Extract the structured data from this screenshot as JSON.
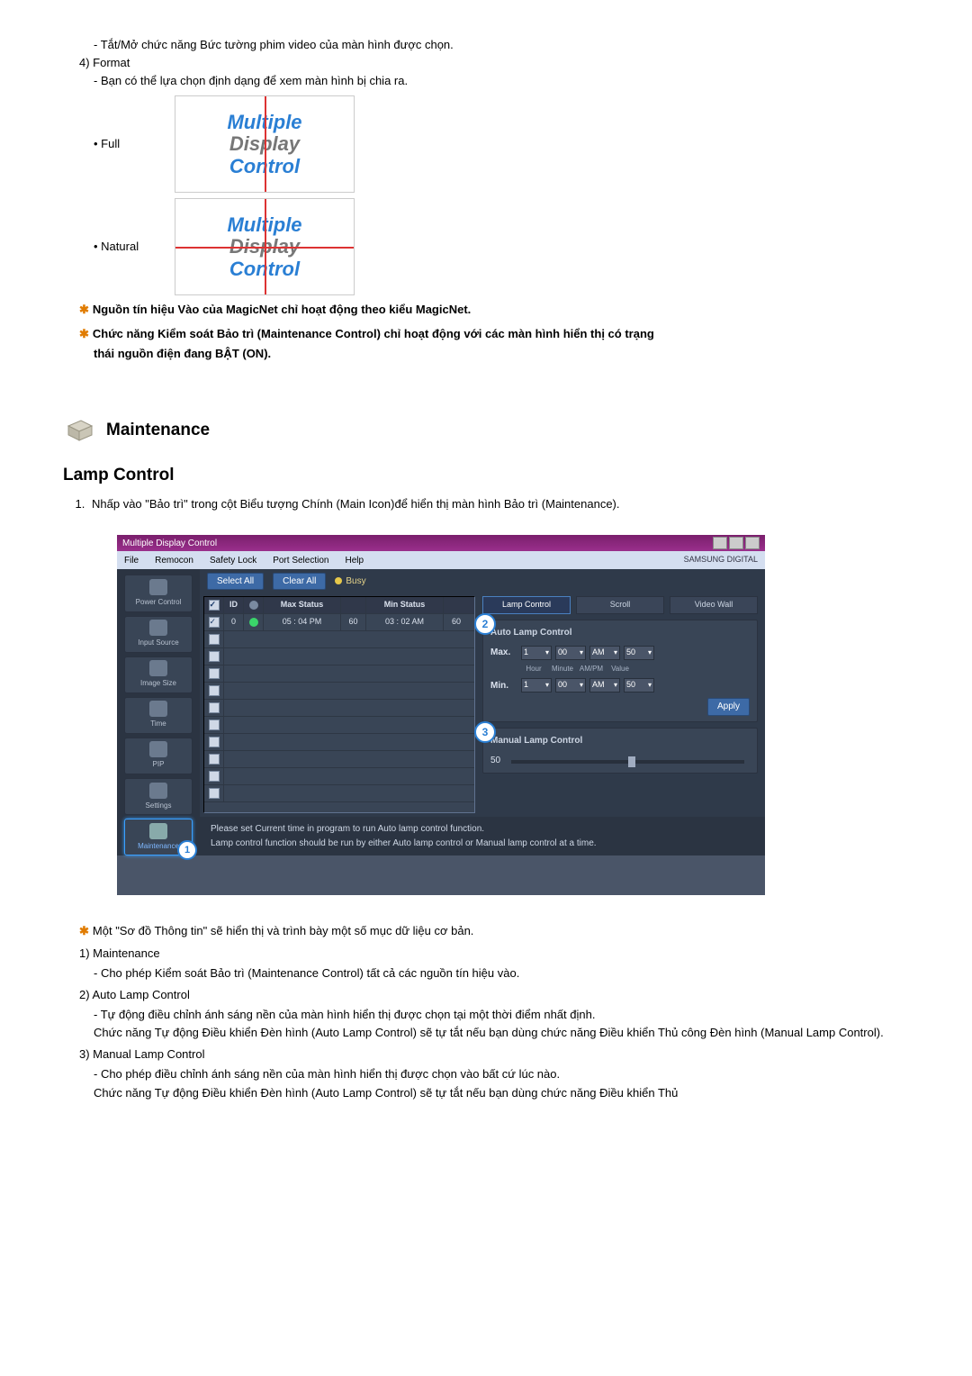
{
  "top": {
    "dash1": "- Tắt/Mở chức năng Bức tường phim video của màn hình được chọn.",
    "item4": "4)  Format",
    "dash4": "- Bạn có thể lựa chọn định dạng để xem màn hình bị chia ra.",
    "opt_full": "Full",
    "opt_natural": "Natural",
    "thumb_line1": "Multiple",
    "thumb_line2": "Display",
    "thumb_line3": "Control",
    "star1": "Nguồn tín hiệu Vào của MagicNet chỉ hoạt động theo kiểu MagicNet.",
    "star2a": "Chức năng Kiểm soát Bảo trì (Maintenance Control) chỉ hoạt động với các màn hình hiển thị có trạng",
    "star2b": "thái nguồn điện đang BẬT (ON)."
  },
  "maintenance": {
    "heading": "Maintenance",
    "subhead": "Lamp Control",
    "step1": "Nhấp vào \"Bảo trì\" trong cột Biểu tượng Chính (Main Icon)để hiển thị màn hình Bảo trì (Maintenance)."
  },
  "screenshot": {
    "title": "Multiple Display Control",
    "menu": {
      "file": "File",
      "remocon": "Remocon",
      "safety": "Safety Lock",
      "port": "Port Selection",
      "help": "Help",
      "brand": "SAMSUNG DIGITAL"
    },
    "btn_select_all": "Select All",
    "btn_clear_all": "Clear All",
    "busy": "Busy",
    "sidebar": [
      {
        "label": "Power Control"
      },
      {
        "label": "Input Source"
      },
      {
        "label": "Image Size"
      },
      {
        "label": "Time"
      },
      {
        "label": "PIP"
      },
      {
        "label": "Settings"
      },
      {
        "label": "Maintenance"
      }
    ],
    "badge_maintenance": "1",
    "grid": {
      "hdr_chk": "✓",
      "hdr_id": "ID",
      "hdr_st": "",
      "hdr_max": "Max Status",
      "hdr_maxv": "",
      "hdr_min": "Min Status",
      "hdr_minv": "",
      "row": {
        "id": "0",
        "max": "05 : 04 PM",
        "maxv": "60",
        "min": "03 : 02 AM",
        "minv": "60"
      }
    },
    "tabs": {
      "lamp": "Lamp Control",
      "scroll": "Scroll",
      "video": "Video Wall"
    },
    "auto": {
      "badge": "2",
      "title": "Auto Lamp Control",
      "max": "Max.",
      "min": "Min.",
      "h1": "1",
      "m1": "00",
      "ap1": "AM",
      "v1": "50",
      "h2": "1",
      "m2": "00",
      "ap2": "AM",
      "v2": "50",
      "sub_hour": "Hour",
      "sub_min": "Minute",
      "sub_ampm": "AM/PM",
      "sub_val": "Value",
      "apply": "Apply"
    },
    "manual": {
      "badge": "3",
      "title": "Manual Lamp Control",
      "value": "50"
    },
    "footer1": "Please set Current time in program to run Auto lamp control function.",
    "footer2": "Lamp control function should be run by either Auto lamp control or Manual lamp control at a time."
  },
  "bottom": {
    "info_star": "Một \"Sơ đồ Thông tin\" sẽ hiển thị và trình bày một số mục dữ liệu cơ bản.",
    "i1": "1)  Maintenance",
    "i1d": "- Cho phép Kiểm soát Bảo trì (Maintenance Control) tất cả các nguồn tín hiệu vào.",
    "i2": "2)  Auto Lamp Control",
    "i2d": "- Tự động điều chỉnh ánh sáng nền của màn hình hiển thị được chọn tại một thời điểm nhất định.",
    "i2c": "Chức năng Tự động Điều khiển Đèn hình (Auto Lamp Control) sẽ tự tắt nếu bạn dùng chức năng Điều khiển Thủ công Đèn hình (Manual Lamp Control).",
    "i3": "3)  Manual Lamp Control",
    "i3d": "- Cho phép điều chỉnh ánh sáng nền của màn hình hiển thị được chọn vào bất cứ lúc nào.",
    "i3c": "Chức năng Tự động Điều khiển Đèn hình (Auto Lamp Control) sẽ tự tắt nếu bạn dùng chức năng Điều khiển Thủ"
  }
}
